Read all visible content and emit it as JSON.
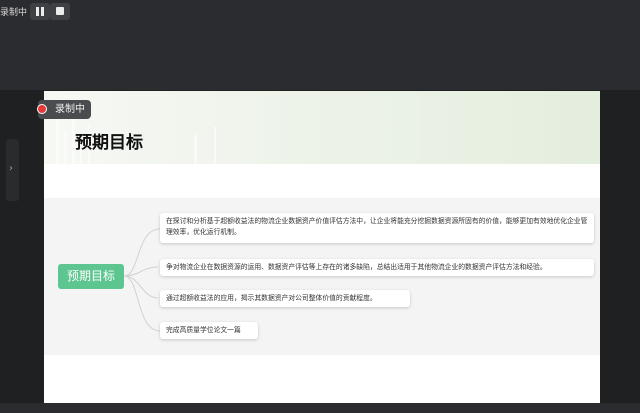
{
  "recorder": {
    "label": "录制中",
    "pause_icon": "pause-icon",
    "stop_icon": "stop-icon"
  },
  "side_handle": {
    "icon": "chevron-right-icon",
    "glyph": "›"
  },
  "slide": {
    "title": "预期目标",
    "recording_badge": "录制中",
    "mindmap": {
      "root": "预期目标",
      "branches": [
        "在探讨和分析基于超额收益法的物流企业数据资产价值评估方法中，让企业将能充分挖掘数据资源所固有的价值，能够更加有效地优化企业管理效率，优化运行机制。",
        "争对物流企业在数据资源的运用、数据资产评估等上存在的诸多缺陷，总结出适用于其他物流企业的数据资产评估方法和经验。",
        "通过超额收益法的应用，揭示其数据资产对公司整体价值的贡献程度。",
        "完成高质量学位论文一篇"
      ]
    }
  },
  "colors": {
    "accent": "#5cc590",
    "record": "#e43a3a"
  }
}
